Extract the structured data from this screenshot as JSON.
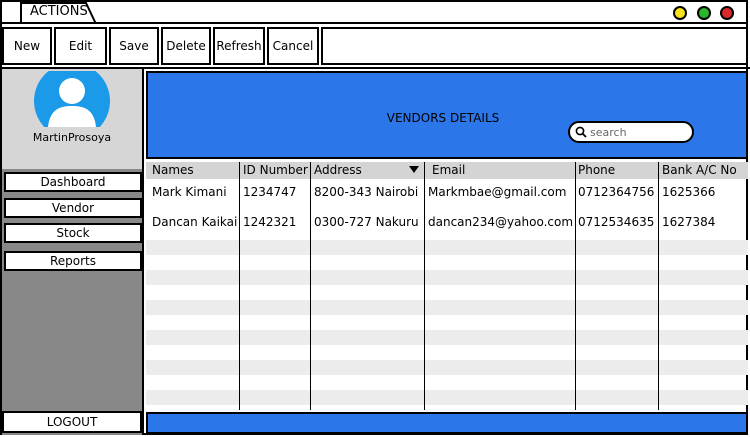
{
  "window": {
    "tab_label": "ACTIONS"
  },
  "toolbar": {
    "buttons": [
      "New",
      "Edit",
      "Save",
      "Delete",
      "Refresh",
      "Cancel"
    ]
  },
  "sidebar": {
    "username": "MartinProsoya",
    "items": [
      "Dashboard",
      "Vendor",
      "Stock",
      "Reports"
    ],
    "logout_label": "LOGOUT"
  },
  "main": {
    "title": "VENDORS DETAILS",
    "search": {
      "placeholder": "search",
      "value": ""
    }
  },
  "table": {
    "columns": [
      "Names",
      "ID Number",
      "Address",
      "Email",
      "Phone",
      "Bank A/C No"
    ],
    "rows": [
      [
        "Mark Kimani",
        "1234747",
        "8200-343 Nairobi",
        "Markmbae@gmail.com",
        "0712364756",
        "1625366"
      ],
      [
        "Dancan Kaikai",
        "1242321",
        "0300-727 Nakuru",
        "dancan234@yahoo.com",
        "0712534635",
        "1627384"
      ]
    ]
  },
  "colors": {
    "accent": "#2b76e8",
    "sidebar": "#888888",
    "profile_bg": "#d6d6d6"
  }
}
